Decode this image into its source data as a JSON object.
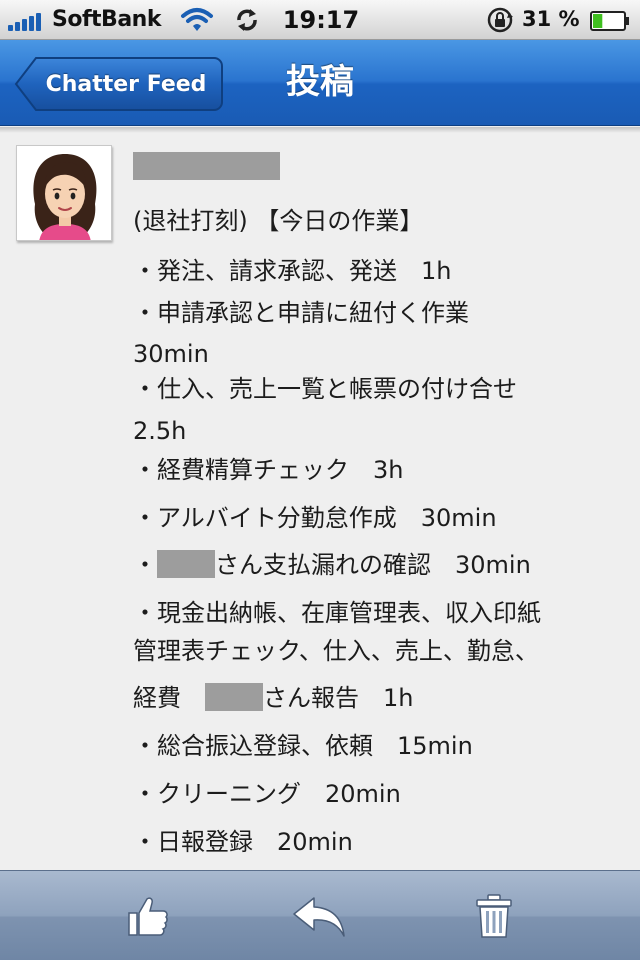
{
  "status_bar": {
    "carrier": "SoftBank",
    "time": "19:17",
    "battery_percent": "31 %",
    "battery_level": 0.31,
    "icons": [
      "signal-icon",
      "wifi-icon",
      "sync-icon",
      "rotation-lock-icon",
      "battery-icon"
    ]
  },
  "nav": {
    "back_label": "Chatter Feed",
    "title": "投稿"
  },
  "post": {
    "lines": [
      "(退社打刻) 【今日の作業】",
      "・発注、請求承認、発送　1h",
      "・申請承認と申請に紐付く作業",
      "30min",
      "・仕入、売上一覧と帳票の付け合せ",
      "2.5h",
      "・経費精算チェック　3h",
      "・アルバイト分勤怠作成　30min",
      "・",
      "さん支払漏れの確認　30min",
      "・現金出納帳、在庫管理表、収入印紙",
      "管理表チェック、仕入、売上、勤怠、",
      "経費　",
      "さん報告　1h",
      "・総合振込登録、依頼　15min",
      "・クリーニング　20min",
      "・日報登録　20min"
    ]
  },
  "toolbar": {
    "icons": [
      "like-icon",
      "reply-icon",
      "delete-icon"
    ]
  },
  "colors": {
    "nav_blue": "#2a74cf",
    "toolbar": "#8ea2bd",
    "background": "#efefef",
    "redaction": "#9d9d9d"
  }
}
